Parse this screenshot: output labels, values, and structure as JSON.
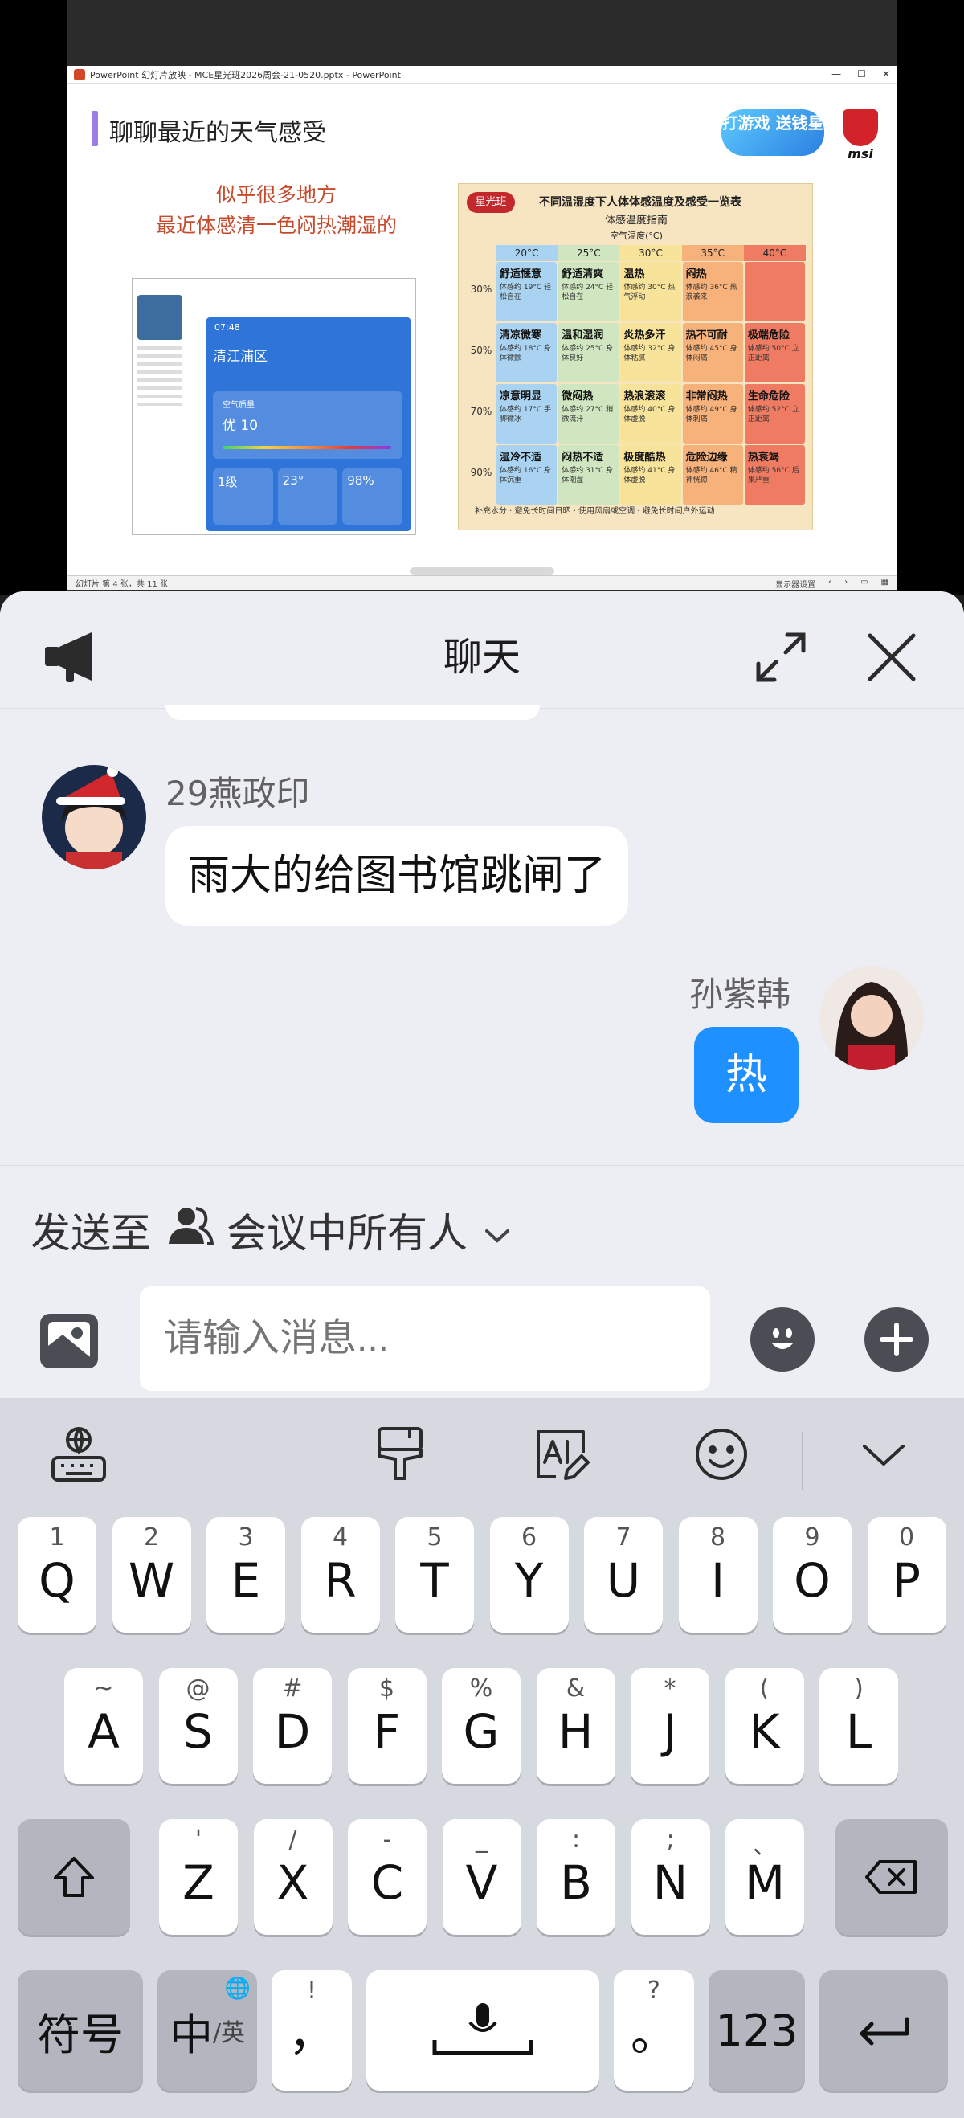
{
  "ppt": {
    "window_title": "PowerPoint 幻灯片放映 - MCE星光班2026周会-21-0520.pptx - PowerPoint",
    "slide_title": "聊聊最近的天气感受",
    "slide_subtitle_line1": "似乎很多地方",
    "slide_subtitle_line2": "最近体感清一色闷热潮湿的",
    "badge_text": "打游戏 送钱星",
    "logo_text": "msi",
    "phone": {
      "time": "07:48",
      "location": "清江浦区",
      "aq_label": "空气质量",
      "aq_value": "优 10",
      "tile1": "1级",
      "tile2": "23°",
      "tile3": "98%"
    },
    "heat_table": {
      "brand": "星光班",
      "title": "不同温湿度下人体体感温度及感受一览表",
      "subtitle": "体感温度指南",
      "axis_label": "空气温度(°C)",
      "temps": [
        "20°C",
        "25°C",
        "30°C",
        "35°C",
        "40°C"
      ],
      "rows": [
        {
          "humidity": "30%",
          "cells": [
            {
              "name": "舒适惬意",
              "desc": "体感约 19°C 轻松自在"
            },
            {
              "name": "舒适清爽",
              "desc": "体感约 24°C 轻松自在"
            },
            {
              "name": "温热",
              "desc": "体感约 30°C 热气浮动"
            },
            {
              "name": "闷热",
              "desc": "体感约 36°C 热浪袭来"
            },
            {
              "name": "",
              "desc": ""
            }
          ]
        },
        {
          "humidity": "50%",
          "cells": [
            {
              "name": "清凉微寒",
              "desc": "体感约 18°C 身体微颤"
            },
            {
              "name": "温和湿润",
              "desc": "体感约 25°C 身体良好"
            },
            {
              "name": "炎热多汗",
              "desc": "体感约 32°C 身体粘腻"
            },
            {
              "name": "热不可耐",
              "desc": "体感约 45°C 身体闷痛"
            },
            {
              "name": "极端危险",
              "desc": "体感约 50°C 立正距离"
            }
          ]
        },
        {
          "humidity": "70%",
          "cells": [
            {
              "name": "凉意明显",
              "desc": "体感约 17°C 手脚微冰"
            },
            {
              "name": "微闷热",
              "desc": "体感约 27°C 稍微流汗"
            },
            {
              "name": "热浪滚滚",
              "desc": "体感约 40°C 身体虚脱"
            },
            {
              "name": "非常闷热",
              "desc": "体感约 49°C 身体刺痛"
            },
            {
              "name": "生命危险",
              "desc": "体感约 52°C 立正距离"
            }
          ]
        },
        {
          "humidity": "90%",
          "cells": [
            {
              "name": "湿冷不适",
              "desc": "体感约 16°C 身体沉重"
            },
            {
              "name": "闷热不适",
              "desc": "体感约 31°C 身体潮湿"
            },
            {
              "name": "极度酷热",
              "desc": "体感约 41°C 身体虚脱"
            },
            {
              "name": "危险边缘",
              "desc": "体感约 46°C 精神恍惚"
            },
            {
              "name": "热衰竭",
              "desc": "体感约 56°C 后果严重"
            }
          ]
        }
      ],
      "tips": "补充水分 · 避免长时间日晒 · 使用风扇或空调 · 避免长时间户外运动"
    },
    "status_left": "幻灯片 第 4 张，共 11 张",
    "status_right": "显示器设置"
  },
  "chat": {
    "title": "聊天",
    "incoming": {
      "sender": "29燕政印",
      "text": "雨大的给图书馆跳闸了"
    },
    "outgoing": {
      "sender": "孙紫韩",
      "text": "热"
    },
    "send_to_label": "发送至",
    "recipient": "会议中所有人",
    "input_placeholder": "请输入消息..."
  },
  "keyboard": {
    "row1": [
      {
        "sup": "1",
        "main": "Q"
      },
      {
        "sup": "2",
        "main": "W"
      },
      {
        "sup": "3",
        "main": "E"
      },
      {
        "sup": "4",
        "main": "R"
      },
      {
        "sup": "5",
        "main": "T"
      },
      {
        "sup": "6",
        "main": "Y"
      },
      {
        "sup": "7",
        "main": "U"
      },
      {
        "sup": "8",
        "main": "I"
      },
      {
        "sup": "9",
        "main": "O"
      },
      {
        "sup": "0",
        "main": "P"
      }
    ],
    "row2": [
      {
        "sup": "~",
        "main": "A"
      },
      {
        "sup": "@",
        "main": "S"
      },
      {
        "sup": "#",
        "main": "D"
      },
      {
        "sup": "$",
        "main": "F"
      },
      {
        "sup": "%",
        "main": "G"
      },
      {
        "sup": "&",
        "main": "H"
      },
      {
        "sup": "*",
        "main": "J"
      },
      {
        "sup": "(",
        "main": "K"
      },
      {
        "sup": ")",
        "main": "L"
      }
    ],
    "row3": [
      {
        "sup": "'",
        "main": "Z"
      },
      {
        "sup": "/",
        "main": "X"
      },
      {
        "sup": "-",
        "main": "C"
      },
      {
        "sup": "_",
        "main": "V"
      },
      {
        "sup": ":",
        "main": "B"
      },
      {
        "sup": ";",
        "main": "N"
      },
      {
        "sup": "、",
        "main": "M"
      }
    ],
    "symbols_label": "符号",
    "lang_label": "中",
    "lang_sub": "/英",
    "comma_sup": "!",
    "comma": "，",
    "period_sup": "?",
    "period": "。",
    "num_label": "123"
  },
  "colors": {
    "accent": "#1e90ff",
    "chat_bg": "#eceef3",
    "keyboard_bg": "#d7d9e0",
    "slide_accent": "#c64a2c"
  }
}
